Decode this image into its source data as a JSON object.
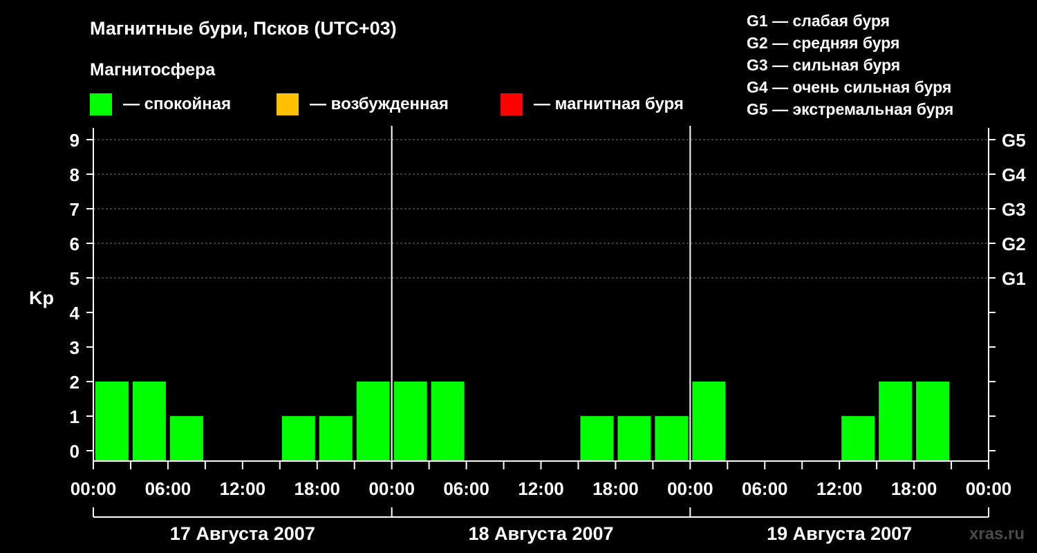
{
  "chart_data": {
    "type": "bar",
    "title": "Магнитные бури, Псков (UTC+03)",
    "legend_title": "Магнитосфера",
    "legend": [
      {
        "label": "— спокойная",
        "color": "#00ff00"
      },
      {
        "label": "— возбужденная",
        "color": "#ffc000"
      },
      {
        "label": "— магнитная буря",
        "color": "#ff0000"
      }
    ],
    "storm_legend": [
      "G1 — слабая буря",
      "G2 — средняя буря",
      "G3 — сильная буря",
      "G4 — очень сильная буря",
      "G5 — экстремальная буря"
    ],
    "ylabel": "Kp",
    "ylim": [
      0,
      9
    ],
    "yticks": [
      "0",
      "1",
      "2",
      "3",
      "4",
      "5",
      "6",
      "7",
      "8",
      "9"
    ],
    "right_ticks": [
      {
        "value": 5,
        "label": "G1"
      },
      {
        "value": 6,
        "label": "G2"
      },
      {
        "value": 7,
        "label": "G3"
      },
      {
        "value": 8,
        "label": "G4"
      },
      {
        "value": 9,
        "label": "G5"
      }
    ],
    "xticks": [
      "00:00",
      "06:00",
      "12:00",
      "18:00",
      "00:00",
      "06:00",
      "12:00",
      "18:00",
      "00:00",
      "06:00",
      "12:00",
      "18:00",
      "00:00"
    ],
    "days": [
      "17 Августа 2007",
      "18 Августа 2007",
      "19 Августа 2007"
    ],
    "intervals_per_day": 8,
    "values": [
      2,
      2,
      1,
      0,
      0,
      1,
      1,
      2,
      2,
      2,
      0,
      0,
      0,
      1,
      1,
      1,
      2,
      0,
      0,
      0,
      1,
      2,
      2,
      0
    ],
    "grid": "dashed at G-levels",
    "watermark": "xras.ru"
  }
}
